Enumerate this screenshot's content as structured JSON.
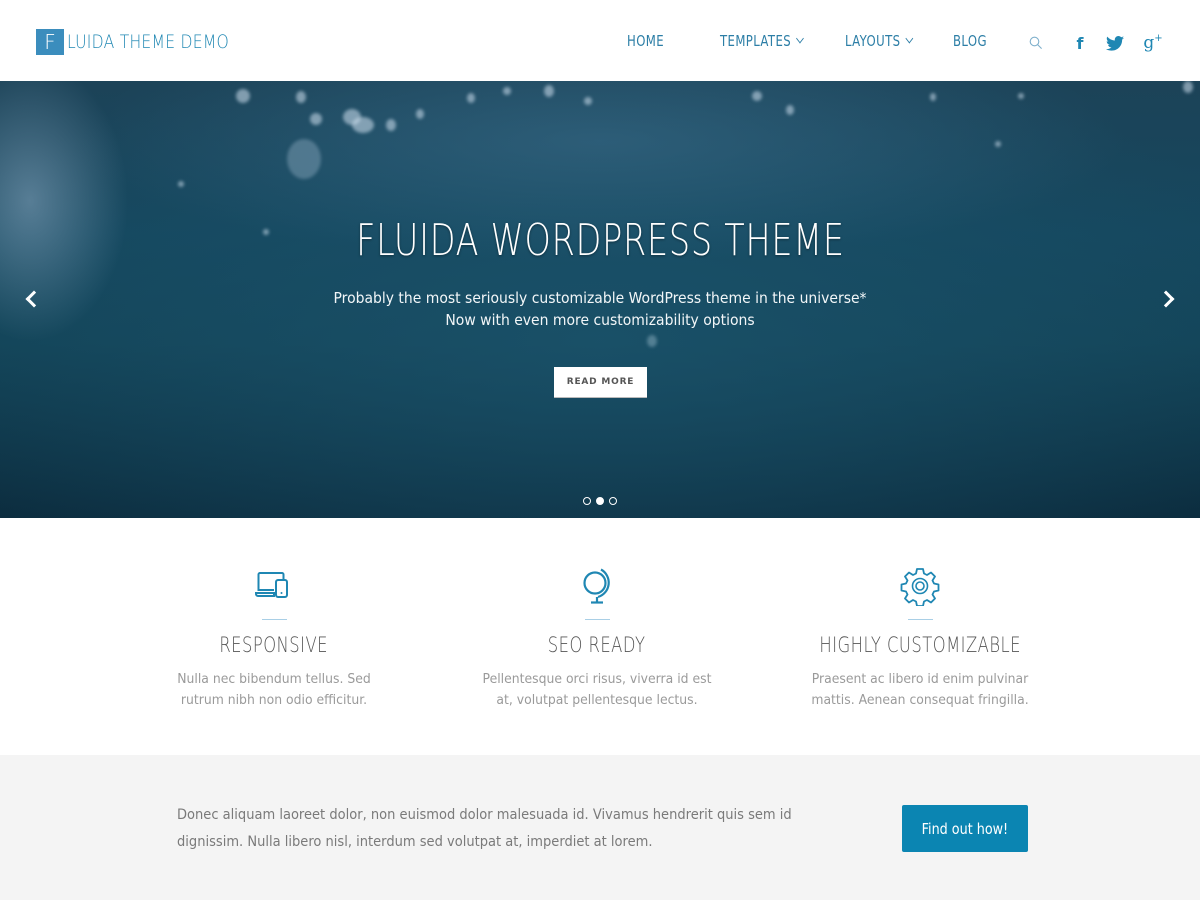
{
  "header": {
    "logo_letter": "F",
    "logo_text": "LUIDA THEME DEMO",
    "nav": [
      {
        "label": "HOME",
        "has_dropdown": false
      },
      {
        "label": "TEMPLATES",
        "has_dropdown": true
      },
      {
        "label": "LAYOUTS",
        "has_dropdown": true
      },
      {
        "label": "BLOG",
        "has_dropdown": false
      }
    ],
    "icons": [
      "search-icon",
      "facebook-icon",
      "twitter-icon",
      "google-plus-icon"
    ],
    "google_plus_glyph": "g",
    "google_plus_sup": "+",
    "facebook_glyph": "f"
  },
  "hero": {
    "title": "FLUIDA WORDPRESS THEME",
    "subtitle_line1": "Probably the most seriously customizable WordPress theme in the universe*",
    "subtitle_line2": "Now with even more customizability options",
    "button_label": "READ MORE",
    "slides_total": 3,
    "active_slide": 2
  },
  "features": [
    {
      "icon": "devices-icon",
      "title": "RESPONSIVE",
      "line1": "Nulla nec bibendum tellus. Sed",
      "line2": "rutrum nibh non odio efficitur."
    },
    {
      "icon": "globe-icon",
      "title": "SEO READY",
      "line1": "Pellentesque orci risus, viverra id est",
      "line2": "at, volutpat pellentesque lectus."
    },
    {
      "icon": "gear-icon",
      "title": "HIGHLY CUSTOMIZABLE",
      "line1": "Praesent ac libero id enim pulvinar",
      "line2": "mattis. Aenean consequat fringilla."
    }
  ],
  "cta": {
    "line1": "Donec aliquam laoreet dolor, non euismod dolor malesuada id. Vivamus hendrerit quis sem id",
    "line2": "dignissim. Nulla libero nisl, interdum sed volutpat at, imperdiet at lorem.",
    "button_label": "Find out how!"
  },
  "colors": {
    "accent": "#1f87b3",
    "button": "#0b85b2",
    "logo_box": "#3b8dbd",
    "cta_background": "#f4f4f4"
  }
}
